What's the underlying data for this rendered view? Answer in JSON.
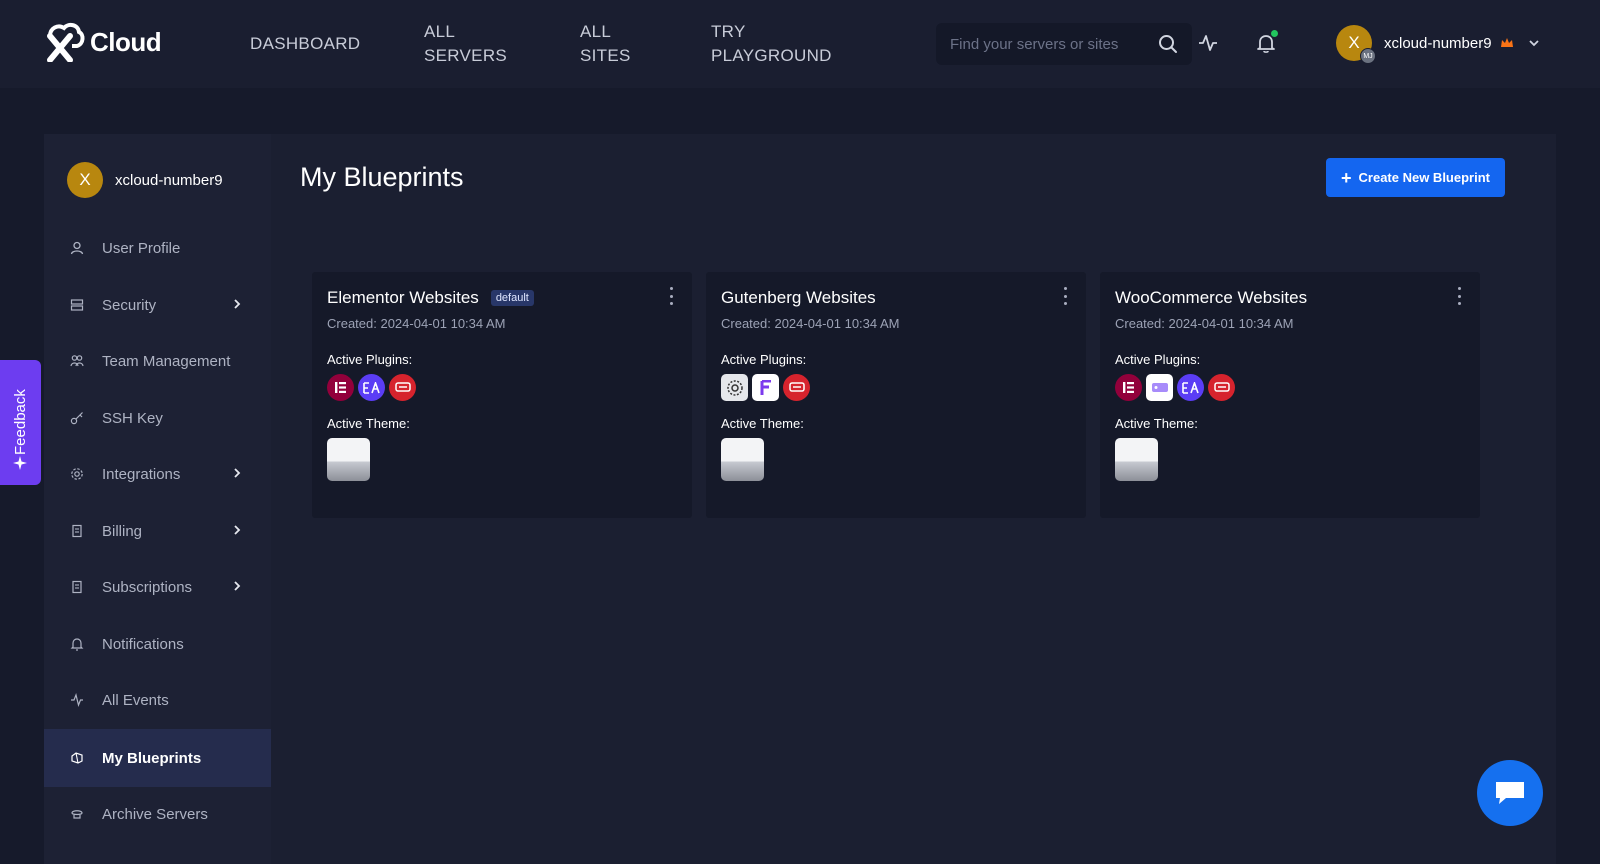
{
  "app": {
    "logo_text": "Cloud"
  },
  "nav": {
    "items": [
      {
        "line1": "DASHBOARD",
        "line2": ""
      },
      {
        "line1": "ALL",
        "line2": "SERVERS"
      },
      {
        "line1": "ALL",
        "line2": "SITES"
      },
      {
        "line1": "TRY",
        "line2": "PLAYGROUND"
      }
    ],
    "search_placeholder": "Find your servers or sites"
  },
  "user": {
    "initial": "X",
    "name": "xcloud-number9",
    "badge": "MJ"
  },
  "sidebar": {
    "user_name": "xcloud-number9",
    "items": [
      {
        "label": "User Profile",
        "icon": "user-icon",
        "has_arrow": false
      },
      {
        "label": "Security",
        "icon": "security-icon",
        "has_arrow": true
      },
      {
        "label": "Team Management",
        "icon": "team-icon",
        "has_arrow": false
      },
      {
        "label": "SSH Key",
        "icon": "key-icon",
        "has_arrow": false
      },
      {
        "label": "Integrations",
        "icon": "gear-icon",
        "has_arrow": true
      },
      {
        "label": "Billing",
        "icon": "billing-icon",
        "has_arrow": true
      },
      {
        "label": "Subscriptions",
        "icon": "subscriptions-icon",
        "has_arrow": true
      },
      {
        "label": "Notifications",
        "icon": "bell-icon",
        "has_arrow": false
      },
      {
        "label": "All Events",
        "icon": "activity-icon",
        "has_arrow": false
      },
      {
        "label": "My Blueprints",
        "icon": "blueprint-icon",
        "has_arrow": false,
        "active": true
      },
      {
        "label": "Archive Servers",
        "icon": "archive-icon",
        "has_arrow": false
      }
    ]
  },
  "main": {
    "title": "My Blueprints",
    "create_button": "Create New Blueprint",
    "cards": [
      {
        "title": "Elementor Websites",
        "badge": "default",
        "created": "Created: 2024-04-01 10:34 AM",
        "plugins_label": "Active Plugins:",
        "theme_label": "Active Theme:",
        "plugins": [
          "elementor-icon",
          "essential-addons-icon",
          "plugin-red-icon"
        ]
      },
      {
        "title": "Gutenberg Websites",
        "badge": "",
        "created": "Created: 2024-04-01 10:34 AM",
        "plugins_label": "Active Plugins:",
        "theme_label": "Active Theme:",
        "plugins": [
          "pattern-plugin-icon",
          "fluent-forms-icon",
          "plugin-red-icon"
        ]
      },
      {
        "title": "WooCommerce Websites",
        "badge": "",
        "created": "Created: 2024-04-01 10:34 AM",
        "plugins_label": "Active Plugins:",
        "theme_label": "Active Theme:",
        "plugins": [
          "elementor-icon",
          "woocommerce-icon",
          "essential-addons-icon",
          "plugin-red-icon"
        ]
      }
    ]
  },
  "feedback": {
    "label": "Feedback"
  },
  "colors": {
    "accent": "#1466f0",
    "feedback": "#6d3df0",
    "avatar": "#b8870f",
    "active_bg": "#252c4d"
  }
}
